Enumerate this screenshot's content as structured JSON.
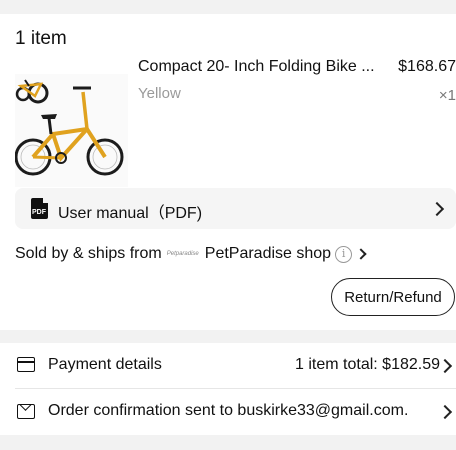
{
  "items_section": {
    "title": "1 item",
    "product": {
      "name": "Compact 20- Inch Folding Bike ...",
      "price": "$168.67",
      "variant": "Yellow",
      "quantity": "×1",
      "colors": {
        "frame": "#e0a21f",
        "tire": "#1c1c1c"
      }
    },
    "manual": {
      "label": "User manual（PDF)",
      "icon_text": "PDF"
    },
    "seller": {
      "prefix": "Sold by & ships from",
      "logo_text": "Petparadise",
      "shop_name": "PetParadise shop"
    },
    "return_button": "Return/Refund"
  },
  "summary": {
    "payment_label": "Payment details",
    "payment_value": "1 item total: $182.59",
    "order_label": "Order confirmation sent to buskirke33@gmail.com."
  }
}
